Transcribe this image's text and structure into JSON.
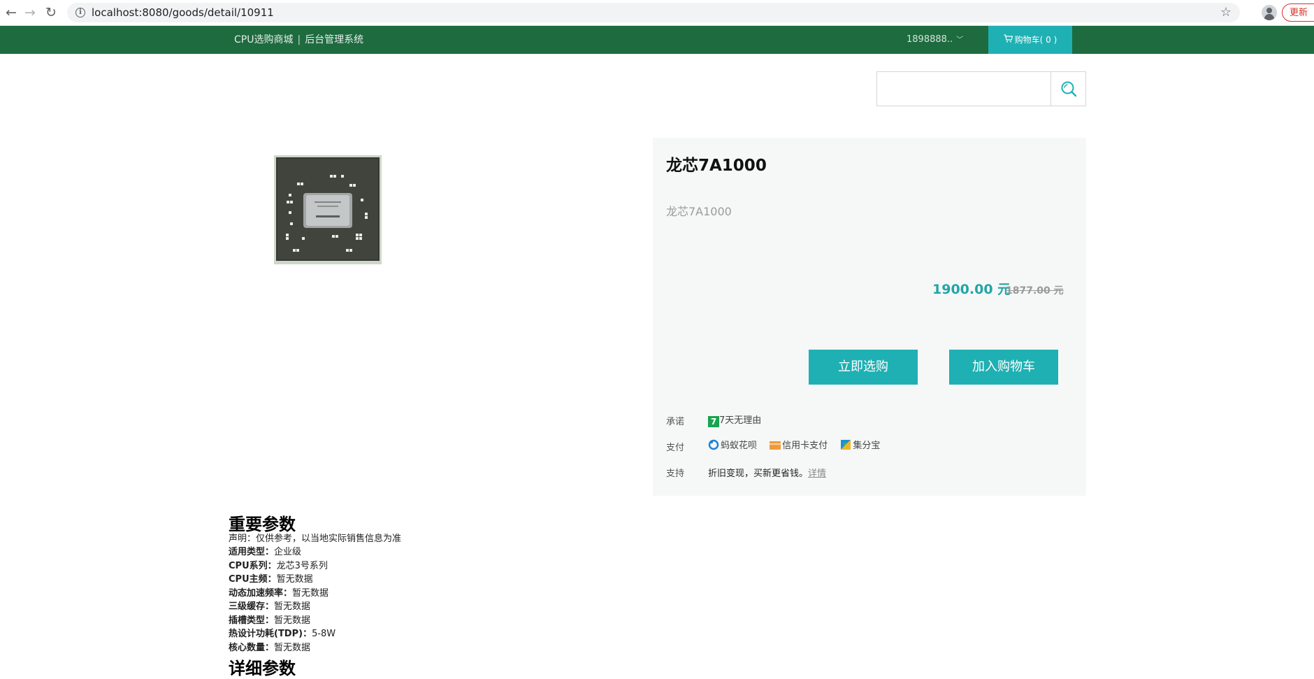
{
  "browser": {
    "url": "localhost:8080/goods/detail/10911",
    "update_label": "更新"
  },
  "header": {
    "brand": "CPU选购商城",
    "separator": "|",
    "admin_link": "后台管理系统",
    "user": "1898888..",
    "cart_label": "购物车( 0 )"
  },
  "search": {
    "placeholder": ""
  },
  "product": {
    "title": "龙芯7A1000",
    "subtitle": "龙芯7A1000",
    "price": "1900.00",
    "price_unit": "元",
    "original_price": "1877.00 元",
    "buy_label": "立即选购",
    "add_cart_label": "加入购物车",
    "promise_label": "承诺",
    "promise_badge": "7",
    "promise_text": "7天无理由",
    "pay_label": "支付",
    "pay_methods": [
      "蚂蚁花呗",
      "信用卡支付",
      "集分宝"
    ],
    "support_label": "支持",
    "support_text": "折旧变现，买新更省钱。",
    "support_link": "详情"
  },
  "specs": {
    "heading": "重要参数",
    "items": [
      {
        "key": "",
        "value": "声明：仅供参考，以当地实际销售信息为准"
      },
      {
        "key": "适用类型：",
        "value": "企业级"
      },
      {
        "key": "CPU系列：",
        "value": "龙芯3号系列"
      },
      {
        "key": "CPU主频：",
        "value": "暂无数据"
      },
      {
        "key": "动态加速频率：",
        "value": "暂无数据"
      },
      {
        "key": "三级缓存：",
        "value": "暂无数据"
      },
      {
        "key": "插槽类型：",
        "value": "暂无数据"
      },
      {
        "key": "热设计功耗(TDP)：",
        "value": "5-8W"
      },
      {
        "key": "核心数量：",
        "value": "暂无数据"
      }
    ],
    "heading_2": "详细参数"
  },
  "colors": {
    "header_bg": "#1d6b3f",
    "accent": "#1fb0b3",
    "price": "#23a5a6",
    "panel_bg": "#f6f7f7"
  },
  "icons": [
    "back-icon",
    "forward-icon",
    "reload-icon",
    "info-icon",
    "star-icon",
    "profile-icon",
    "cart-icon",
    "search-icon",
    "seven-days-icon",
    "huabei-icon",
    "credit-card-icon",
    "jifenbao-icon"
  ]
}
